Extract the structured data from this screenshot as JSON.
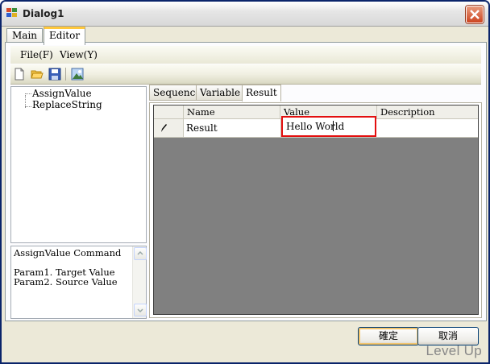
{
  "window": {
    "title": "Dialog1",
    "close_icon": "close-icon",
    "accent": "#0a246a"
  },
  "main_tabs": [
    {
      "label": "Main"
    },
    {
      "label": "Editor"
    }
  ],
  "menu": {
    "items": [
      {
        "label": "File(F)"
      },
      {
        "label": "View(Y)"
      }
    ]
  },
  "toolbar": {
    "icons": [
      "new-file-icon",
      "open-folder-icon",
      "save-icon",
      "image-icon"
    ]
  },
  "tree": {
    "items": [
      {
        "label": "AssignValue"
      },
      {
        "label": "ReplaceString"
      }
    ]
  },
  "description": {
    "lines": [
      "AssignValue Command",
      "",
      "Param1. Target Value",
      "Param2. Source Value"
    ]
  },
  "sub_tabs": [
    {
      "label": "Sequence"
    },
    {
      "label": "Variable"
    },
    {
      "label": "Result"
    }
  ],
  "grid": {
    "columns": [
      "Name",
      "Value",
      "Description"
    ],
    "rows": [
      {
        "name": "Result",
        "value": "Hello World",
        "description": ""
      }
    ],
    "highlight_color": "#e30f0f"
  },
  "buttons": {
    "ok_label": "確定",
    "cancel_label": "取消"
  },
  "watermark": "Level Up"
}
